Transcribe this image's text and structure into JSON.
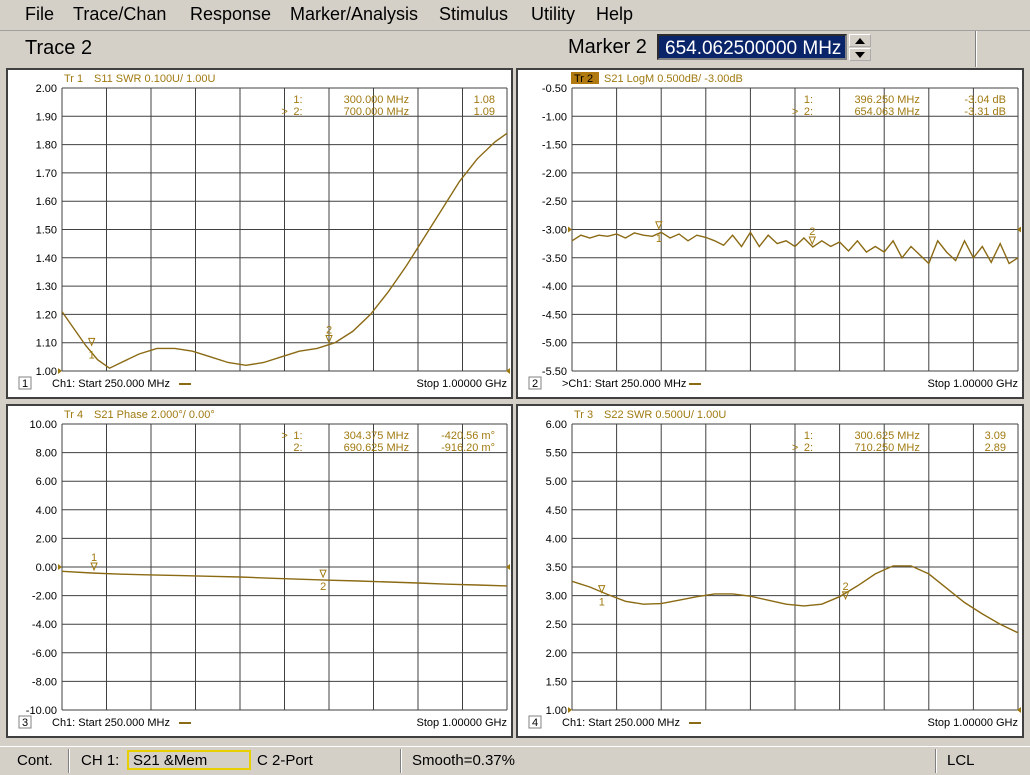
{
  "menu": [
    "File",
    "Trace/Chan",
    "Response",
    "Marker/Analysis",
    "Stimulus",
    "Utility",
    "Help"
  ],
  "active_trace": "Trace 2",
  "marker": {
    "label": "Marker 2",
    "value": "654.062500000 MHz"
  },
  "colors": {
    "trace": "#8b6a14",
    "grid": "#404040",
    "text": "#a07a10",
    "active_tag_bg": "#b07a10"
  },
  "panels": [
    {
      "id": 1,
      "header_tag": "Tr 1",
      "header_rest": "S11 SWR 0.100U/ 1.00U",
      "tag_active": false,
      "yticks": [
        "2.00",
        "1.90",
        "1.80",
        "1.70",
        "1.60",
        "1.50",
        "1.40",
        "1.30",
        "1.20",
        "1.10",
        "1.00"
      ],
      "ylim": [
        1.0,
        2.0
      ],
      "ref_level": 1.0,
      "markers": [
        {
          "active": false,
          "num": "1:",
          "freq": "300.000 MHz",
          "val": "1.08"
        },
        {
          "active": true,
          "num": "2:",
          "freq": "700.000 MHz",
          "val": "1.09"
        }
      ],
      "trace_markers": [
        {
          "label": "1",
          "x": 300,
          "y": 1.08,
          "below": true
        },
        {
          "label": "2",
          "x": 700,
          "y": 1.09,
          "below": false
        }
      ],
      "footer_start": "Ch1: Start  250.000 MHz",
      "footer_stop": "Stop  1.00000 GHz",
      "footer_active": false,
      "chart_data": {
        "type": "line",
        "xlim": [
          250,
          1000
        ],
        "x": [
          250,
          270,
          290,
          310,
          330,
          350,
          380,
          410,
          440,
          470,
          500,
          530,
          560,
          590,
          620,
          650,
          680,
          710,
          740,
          770,
          800,
          830,
          860,
          890,
          920,
          950,
          980,
          1000
        ],
        "values": [
          1.21,
          1.15,
          1.09,
          1.04,
          1.01,
          1.03,
          1.06,
          1.08,
          1.08,
          1.07,
          1.05,
          1.03,
          1.02,
          1.03,
          1.05,
          1.07,
          1.08,
          1.1,
          1.14,
          1.2,
          1.28,
          1.37,
          1.47,
          1.57,
          1.67,
          1.75,
          1.81,
          1.84
        ]
      }
    },
    {
      "id": 2,
      "header_tag": "Tr 2",
      "header_rest": "S21 LogM 0.500dB/ -3.00dB",
      "tag_active": true,
      "yticks": [
        "-0.50",
        "-1.00",
        "-1.50",
        "-2.00",
        "-2.50",
        "-3.00",
        "-3.50",
        "-4.00",
        "-4.50",
        "-5.00",
        "-5.50"
      ],
      "ylim": [
        -5.5,
        -0.5
      ],
      "ref_level": -3.0,
      "markers": [
        {
          "active": false,
          "num": "1:",
          "freq": "396.250 MHz",
          "val": "-3.04 dB"
        },
        {
          "active": true,
          "num": "2:",
          "freq": "654.063 MHz",
          "val": "-3.31 dB"
        }
      ],
      "trace_markers": [
        {
          "label": "1",
          "x": 396,
          "y": -3.04,
          "below": true
        },
        {
          "label": "2",
          "x": 654,
          "y": -3.31,
          "below": false
        }
      ],
      "footer_start": ">Ch1: Start  250.000 MHz",
      "footer_stop": "Stop  1.00000 GHz",
      "footer_active": true,
      "chart_data": {
        "type": "line",
        "xlim": [
          250,
          1000
        ],
        "x": [
          250,
          265,
          280,
          295,
          310,
          325,
          340,
          355,
          370,
          385,
          400,
          415,
          430,
          445,
          460,
          475,
          490,
          505,
          520,
          535,
          550,
          565,
          580,
          595,
          610,
          625,
          640,
          655,
          670,
          685,
          700,
          715,
          730,
          745,
          760,
          775,
          790,
          805,
          820,
          835,
          850,
          865,
          880,
          895,
          910,
          925,
          940,
          955,
          970,
          985,
          1000
        ],
        "values": [
          -3.2,
          -3.1,
          -3.15,
          -3.1,
          -3.12,
          -3.08,
          -3.15,
          -3.06,
          -3.1,
          -3.12,
          -3.05,
          -3.15,
          -3.08,
          -3.2,
          -3.1,
          -3.14,
          -3.2,
          -3.28,
          -3.1,
          -3.3,
          -3.05,
          -3.3,
          -3.1,
          -3.25,
          -3.2,
          -3.3,
          -3.15,
          -3.31,
          -3.2,
          -3.3,
          -3.22,
          -3.38,
          -3.2,
          -3.4,
          -3.3,
          -3.4,
          -3.2,
          -3.5,
          -3.3,
          -3.45,
          -3.6,
          -3.2,
          -3.4,
          -3.55,
          -3.2,
          -3.5,
          -3.3,
          -3.58,
          -3.25,
          -3.6,
          -3.5
        ]
      }
    },
    {
      "id": 3,
      "header_tag": "Tr 4",
      "header_rest": "S21 Phase 2.000°/ 0.00°",
      "tag_active": false,
      "yticks": [
        "10.00",
        "8.00",
        "6.00",
        "4.00",
        "2.00",
        "0.00",
        "-2.00",
        "-4.00",
        "-6.00",
        "-8.00",
        "-10.00"
      ],
      "ylim": [
        -10,
        10
      ],
      "ref_level": 0,
      "markers": [
        {
          "active": true,
          "num": "1:",
          "freq": "304.375 MHz",
          "val": "-420.56 m°"
        },
        {
          "active": false,
          "num": "2:",
          "freq": "690.625 MHz",
          "val": "-916.20 m°"
        }
      ],
      "trace_markers": [
        {
          "label": "1",
          "x": 304,
          "y": -0.42,
          "below": false
        },
        {
          "label": "2",
          "x": 690,
          "y": -0.92,
          "below": true
        }
      ],
      "footer_start": "Ch1: Start  250.000 MHz",
      "footer_stop": "Stop  1.00000 GHz",
      "footer_active": false,
      "chart_data": {
        "type": "line",
        "xlim": [
          250,
          1000
        ],
        "x": [
          250,
          300,
          350,
          400,
          450,
          500,
          550,
          600,
          650,
          700,
          750,
          800,
          850,
          900,
          950,
          1000
        ],
        "values": [
          -0.3,
          -0.42,
          -0.5,
          -0.55,
          -0.6,
          -0.65,
          -0.7,
          -0.78,
          -0.85,
          -0.92,
          -0.98,
          -1.05,
          -1.12,
          -1.2,
          -1.26,
          -1.32
        ]
      }
    },
    {
      "id": 4,
      "header_tag": "Tr 3",
      "header_rest": "S22 SWR 0.500U/ 1.00U",
      "tag_active": false,
      "yticks": [
        "6.00",
        "5.50",
        "5.00",
        "4.50",
        "4.00",
        "3.50",
        "3.00",
        "2.50",
        "2.00",
        "1.50",
        "1.00"
      ],
      "ylim": [
        1.0,
        6.0
      ],
      "ref_level": 1.0,
      "markers": [
        {
          "active": false,
          "num": "1:",
          "freq": "300.625 MHz",
          "val": "3.09"
        },
        {
          "active": true,
          "num": "2:",
          "freq": "710.250 MHz",
          "val": "2.89"
        }
      ],
      "trace_markers": [
        {
          "label": "1",
          "x": 300,
          "y": 3.0,
          "below": true
        },
        {
          "label": "2",
          "x": 710,
          "y": 2.89,
          "below": false
        }
      ],
      "footer_start": "Ch1: Start  250.000 MHz",
      "footer_stop": "Stop  1.00000 GHz",
      "footer_active": false,
      "chart_data": {
        "type": "line",
        "xlim": [
          250,
          1000
        ],
        "x": [
          250,
          280,
          310,
          340,
          370,
          400,
          430,
          460,
          490,
          520,
          550,
          580,
          610,
          640,
          670,
          700,
          730,
          760,
          790,
          820,
          850,
          880,
          910,
          940,
          970,
          1000
        ],
        "values": [
          3.25,
          3.15,
          3.02,
          2.9,
          2.85,
          2.86,
          2.92,
          2.98,
          3.03,
          3.03,
          2.99,
          2.92,
          2.85,
          2.82,
          2.85,
          2.98,
          3.17,
          3.38,
          3.52,
          3.52,
          3.38,
          3.13,
          2.88,
          2.68,
          2.5,
          2.35
        ]
      }
    }
  ],
  "status": {
    "cont": "Cont.",
    "ch": "CH 1:",
    "meas": "S21 &Mem",
    "cal": "C  2-Port",
    "smooth": "Smooth=0.37%",
    "lcl": "LCL"
  }
}
